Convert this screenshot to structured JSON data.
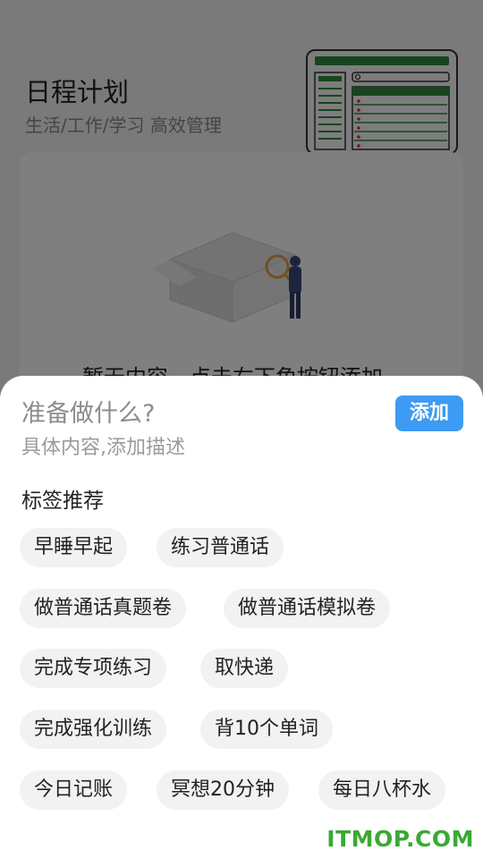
{
  "background_page": {
    "title": "日程计划",
    "subtitle": "生活/工作/学习 高效管理",
    "empty_text": "暂无内容，点击右下角按钮添加~"
  },
  "sheet": {
    "title_placeholder": "准备做什么?",
    "desc_placeholder": "具体内容,添加描述",
    "add_label": "添加",
    "tags_heading": "标签推荐",
    "tags": [
      "早睡早起",
      "练习普通话",
      "做普通话真题卷",
      "做普通话模拟卷",
      "完成专项练习",
      "取快递",
      "完成强化训练",
      "背10个单词",
      "今日记账",
      "冥想20分钟",
      "每日八杯水"
    ]
  },
  "watermark": "ITMOP.COM",
  "colors": {
    "accent": "#3d9bf3",
    "tag_bg": "#f1f2f3",
    "watermark": "#3aa935",
    "illustration_green": "#2e8b3c"
  }
}
